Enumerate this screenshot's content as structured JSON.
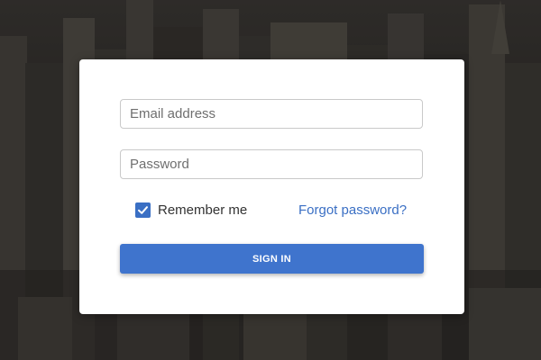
{
  "login_form": {
    "email": {
      "placeholder": "Email address",
      "value": ""
    },
    "password": {
      "placeholder": "Password",
      "value": ""
    },
    "remember_me": {
      "label": "Remember me",
      "checked": true
    },
    "forgot_password_label": "Forgot password?",
    "sign_in_label": "SIGN IN"
  },
  "icons": {
    "checkbox": "check-icon"
  },
  "colors": {
    "accent": "#3f74cd",
    "link": "#3a6fc4",
    "card_background": "#ffffff",
    "field_border": "#c9c9c9"
  }
}
